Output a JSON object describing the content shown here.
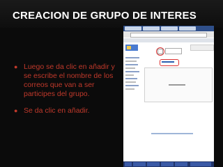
{
  "slide": {
    "title": "CREACION DE GRUPO DE INTERES",
    "bullets": [
      "Luego se da clic en añadir y se escribe el nombre de los correos que van a ser participes del grupo.",
      "Se da clic en añadir."
    ]
  },
  "colors": {
    "title": "#ffffff",
    "bullet_text": "#c0392b",
    "background": "#0b0b0b"
  },
  "screenshot": {
    "icons": [
      "browser-tab-icon",
      "add-icon",
      "taskbar-icon"
    ]
  }
}
